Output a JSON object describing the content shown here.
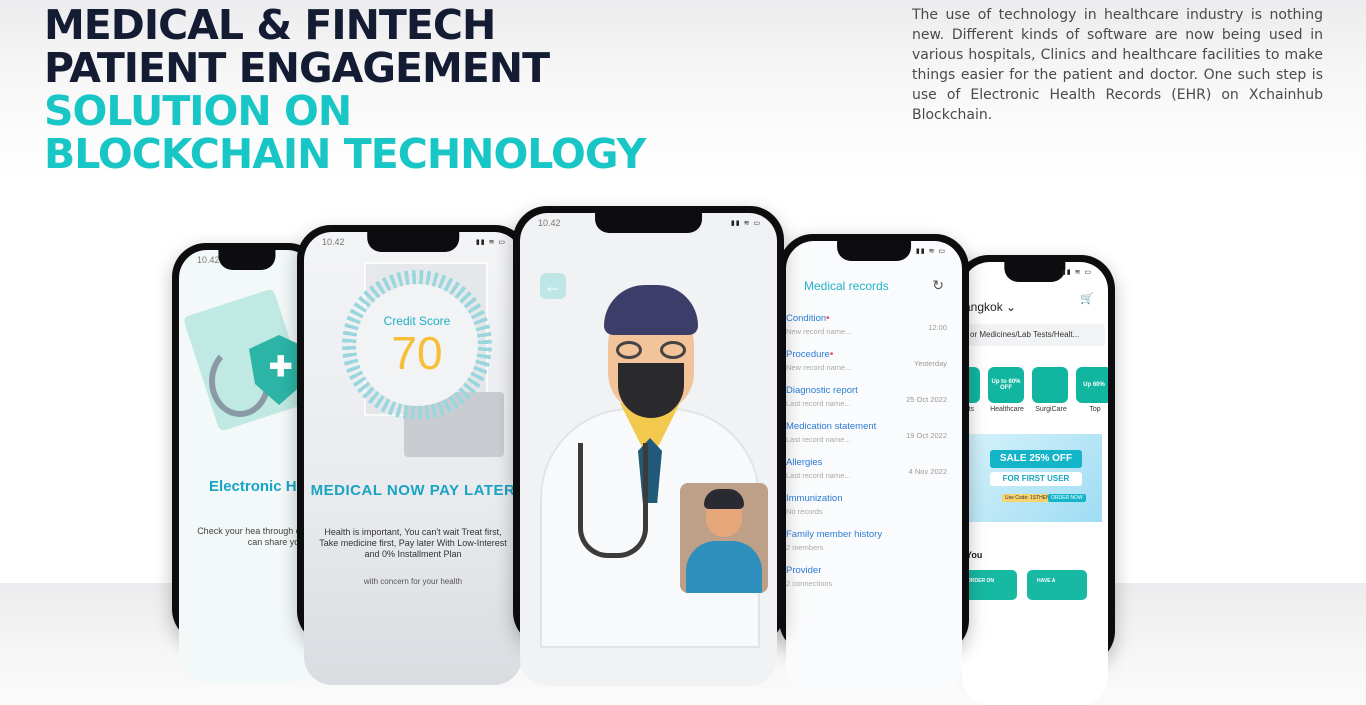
{
  "hero": {
    "line1": "MEDICAL & FINTECH",
    "line2": "PATIENT ENGAGEMENT",
    "line3": "SOLUTION ON",
    "line4": "BLOCKCHAIN TECHNOLOGY"
  },
  "intro": "The use of technology in healthcare industry is nothing new. Different kinds of software are now being used in various hospitals, Clinics and healthcare facilities to make things easier for the patient and doctor. One such step is use of Electronic Health Records (EHR) on Xchainhub Blockchain.",
  "colors": {
    "dark": "#141c33",
    "teal": "#18c6c6"
  },
  "status_time": "10.42",
  "phone1": {
    "title": "Electronic Health Re",
    "text": "Check your hea through our Bl Safe and can share your"
  },
  "phone2": {
    "gauge_label": "Credit Score",
    "gauge_value": "70",
    "title": "MEDICAL NOW PAY LATER",
    "text": "Health is important, You can't wait Treat first, Take medicine first, Pay later With Low-Interest and 0% Installment Plan",
    "footer": "with concern for your health"
  },
  "phone3": {
    "back_icon": "arrow-left-icon"
  },
  "phone4": {
    "title": "Medical records",
    "records": [
      {
        "label": "Condition",
        "required": true,
        "sub": "New record name...",
        "date": "12:00"
      },
      {
        "label": "Procedure",
        "required": true,
        "sub": "New record name...",
        "date": "Yesterday"
      },
      {
        "label": "Diagnostic report",
        "required": false,
        "sub": "Last record name...",
        "date": "25 Oct 2022"
      },
      {
        "label": "Medication statement",
        "required": false,
        "sub": "Last record name...",
        "date": "19 Oct 2022"
      },
      {
        "label": "Allergies",
        "required": false,
        "sub": "Last record name...",
        "date": "4 Nov 2022"
      },
      {
        "label": "Immunization",
        "required": false,
        "sub": "No records",
        "date": ""
      },
      {
        "label": "Family member history",
        "required": false,
        "sub": "2 members",
        "date": ""
      },
      {
        "label": "Provider",
        "required": false,
        "sub": "2 connections",
        "date": ""
      }
    ]
  },
  "phone5": {
    "location": "angkok",
    "search": "or Medicines/Lab Tests/Healt...",
    "categories": [
      {
        "tile": "",
        "name": "b Tests"
      },
      {
        "tile": "Up to 60% OFF",
        "name": "Healthcare"
      },
      {
        "tile": "",
        "name": "SurgiCare"
      },
      {
        "tile": "Up 60%",
        "name": "Top"
      }
    ],
    "sale": "SALE 25% OFF",
    "first_user": "FOR FIRST USER",
    "code": "Use Code: 1STHEN",
    "order_now": "ORDER NOW",
    "section": "You",
    "cards": [
      "ORDER ON",
      "HAVE A"
    ]
  }
}
